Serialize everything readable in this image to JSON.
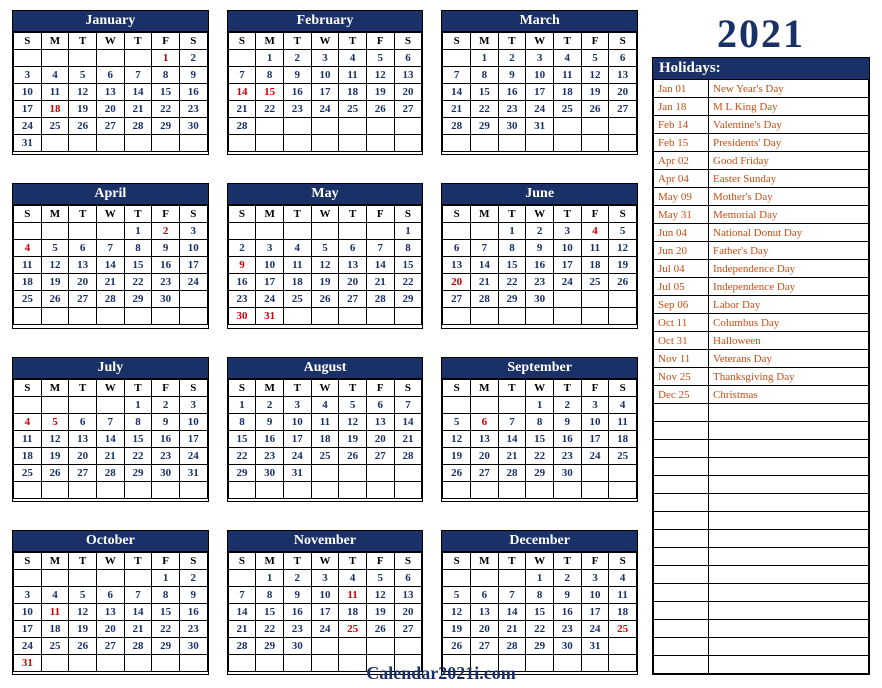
{
  "year": "2021",
  "footer": "Calendar2021i.com",
  "dayLabels": [
    "S",
    "M",
    "T",
    "W",
    "T",
    "F",
    "S"
  ],
  "holidaysTitle": "Holidays:",
  "months": [
    {
      "name": "January",
      "start": 5,
      "days": 31,
      "red": [
        1,
        18
      ]
    },
    {
      "name": "February",
      "start": 1,
      "days": 28,
      "red": [
        14,
        15
      ]
    },
    {
      "name": "March",
      "start": 1,
      "days": 31,
      "red": []
    },
    {
      "name": "April",
      "start": 4,
      "days": 30,
      "red": [
        2,
        4
      ]
    },
    {
      "name": "May",
      "start": 6,
      "days": 31,
      "red": [
        9,
        30,
        31
      ]
    },
    {
      "name": "June",
      "start": 2,
      "days": 30,
      "red": [
        4,
        20
      ]
    },
    {
      "name": "July",
      "start": 4,
      "days": 31,
      "red": [
        4,
        5
      ]
    },
    {
      "name": "August",
      "start": 0,
      "days": 31,
      "red": []
    },
    {
      "name": "September",
      "start": 3,
      "days": 30,
      "red": [
        6
      ]
    },
    {
      "name": "October",
      "start": 5,
      "days": 31,
      "red": [
        11,
        31
      ]
    },
    {
      "name": "November",
      "start": 1,
      "days": 30,
      "red": [
        11,
        25
      ]
    },
    {
      "name": "December",
      "start": 3,
      "days": 31,
      "red": [
        25
      ]
    }
  ],
  "holidays": [
    {
      "date": "Jan 01",
      "name": "New Year's Day"
    },
    {
      "date": "Jan 18",
      "name": "M L King Day"
    },
    {
      "date": "Feb 14",
      "name": "Valentine's Day"
    },
    {
      "date": "Feb 15",
      "name": "Presidents' Day"
    },
    {
      "date": "Apr 02",
      "name": "Good Friday"
    },
    {
      "date": "Apr 04",
      "name": "Easter Sunday"
    },
    {
      "date": "May 09",
      "name": "Mother's Day"
    },
    {
      "date": "May 31",
      "name": "Memorial Day"
    },
    {
      "date": "Jun 04",
      "name": "National Donut Day"
    },
    {
      "date": "Jun 20",
      "name": "Father's Day"
    },
    {
      "date": "Jul 04",
      "name": "Independence Day"
    },
    {
      "date": "Jul 05",
      "name": "Independence Day"
    },
    {
      "date": "Sep 06",
      "name": "Labor Day"
    },
    {
      "date": "Oct 11",
      "name": "Columbus Day"
    },
    {
      "date": "Oct 31",
      "name": "Halloween"
    },
    {
      "date": "Nov 11",
      "name": "Veterans Day"
    },
    {
      "date": "Nov 25",
      "name": "Thanksgiving Day"
    },
    {
      "date": "Dec 25",
      "name": "Christmas"
    }
  ],
  "blankHolidayRows": 15,
  "chart_data": {
    "type": "table",
    "title": "2021 Calendar with US Holidays",
    "months": [
      {
        "name": "January",
        "firstWeekday": "Fri",
        "numDays": 31
      },
      {
        "name": "February",
        "firstWeekday": "Mon",
        "numDays": 28
      },
      {
        "name": "March",
        "firstWeekday": "Mon",
        "numDays": 31
      },
      {
        "name": "April",
        "firstWeekday": "Thu",
        "numDays": 30
      },
      {
        "name": "May",
        "firstWeekday": "Sat",
        "numDays": 31
      },
      {
        "name": "June",
        "firstWeekday": "Tue",
        "numDays": 30
      },
      {
        "name": "July",
        "firstWeekday": "Thu",
        "numDays": 31
      },
      {
        "name": "August",
        "firstWeekday": "Sun",
        "numDays": 31
      },
      {
        "name": "September",
        "firstWeekday": "Wed",
        "numDays": 30
      },
      {
        "name": "October",
        "firstWeekday": "Fri",
        "numDays": 31
      },
      {
        "name": "November",
        "firstWeekday": "Mon",
        "numDays": 30
      },
      {
        "name": "December",
        "firstWeekday": "Wed",
        "numDays": 31
      }
    ],
    "holidays": [
      [
        "Jan 01",
        "New Year's Day"
      ],
      [
        "Jan 18",
        "M L King Day"
      ],
      [
        "Feb 14",
        "Valentine's Day"
      ],
      [
        "Feb 15",
        "Presidents' Day"
      ],
      [
        "Apr 02",
        "Good Friday"
      ],
      [
        "Apr 04",
        "Easter Sunday"
      ],
      [
        "May 09",
        "Mother's Day"
      ],
      [
        "May 31",
        "Memorial Day"
      ],
      [
        "Jun 04",
        "National Donut Day"
      ],
      [
        "Jun 20",
        "Father's Day"
      ],
      [
        "Jul 04",
        "Independence Day"
      ],
      [
        "Jul 05",
        "Independence Day"
      ],
      [
        "Sep 06",
        "Labor Day"
      ],
      [
        "Oct 11",
        "Columbus Day"
      ],
      [
        "Oct 31",
        "Halloween"
      ],
      [
        "Nov 11",
        "Veterans Day"
      ],
      [
        "Nov 25",
        "Thanksgiving Day"
      ],
      [
        "Dec 25",
        "Christmas"
      ]
    ]
  }
}
